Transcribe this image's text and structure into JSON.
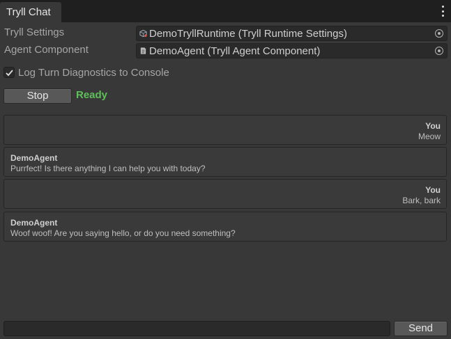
{
  "tab": {
    "title": "Tryll Chat"
  },
  "settings": {
    "tryll_settings_label": "Tryll Settings",
    "tryll_settings_value": "DemoTryllRuntime (Tryll Runtime Settings)",
    "agent_component_label": "Agent Component",
    "agent_component_value": "DemoAgent (Tryll Agent Component)"
  },
  "toggle": {
    "label": "Log Turn Diagnostics to Console",
    "checked": true
  },
  "controls": {
    "stop_label": "Stop",
    "status": "Ready",
    "status_color": "#5fbf5a"
  },
  "messages": [
    {
      "role": "user",
      "sender": "You",
      "text": "Meow"
    },
    {
      "role": "agent",
      "sender": "DemoAgent",
      "text": "Purrfect! Is there anything I can help you with today?"
    },
    {
      "role": "user",
      "sender": "You",
      "text": "Bark, bark"
    },
    {
      "role": "agent",
      "sender": "DemoAgent",
      "text": "Woof woof! Are you saying hello, or do you need something?"
    }
  ],
  "composer": {
    "value": "",
    "send_label": "Send"
  }
}
